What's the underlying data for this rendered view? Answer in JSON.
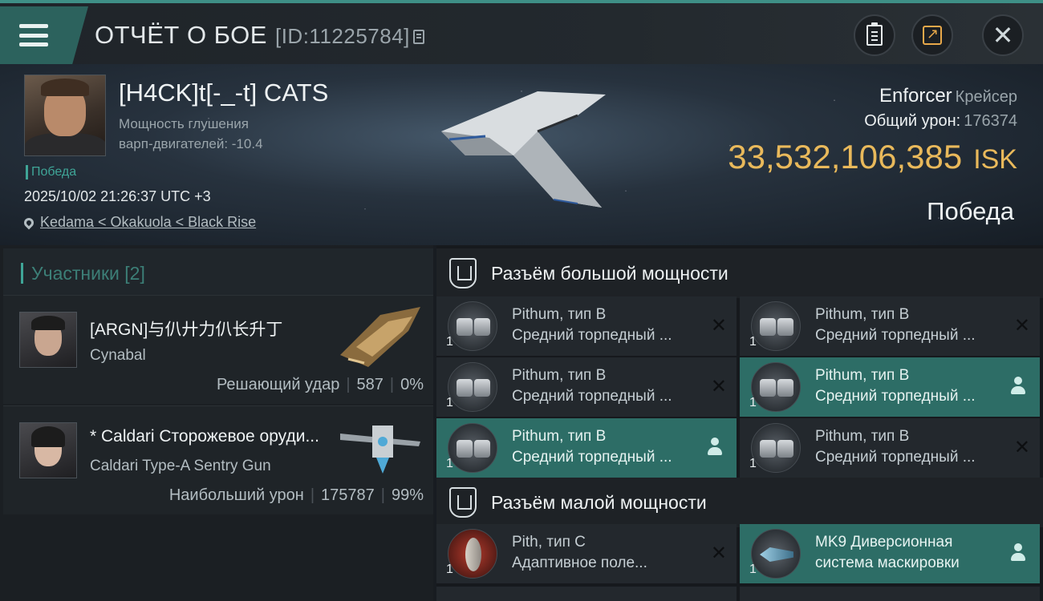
{
  "header": {
    "title": "ОТЧЁТ О БОЕ",
    "report_id": "[ID:11225784]",
    "icons": [
      "menu-icon",
      "copy-icon",
      "clipboard-icon",
      "share-icon",
      "close-icon"
    ]
  },
  "victim": {
    "pilot_name": "[H4CK]t[-_-t] CATS",
    "attribute_line1": "Мощность глушения",
    "attribute_line2": "варп-двигателей: -10.4",
    "tag": "Победа",
    "datetime": "2025/10/02 21:26:37 UTC +3",
    "location": "Kedama < Okakuola < Black Rise",
    "ship_name": "Enforcer",
    "ship_class": "Крейсер",
    "damage_label": "Общий урон:",
    "damage_value": "176374",
    "isk_value": "33,532,106,385",
    "isk_unit": "ISK",
    "result": "Победа"
  },
  "participants": {
    "header": "Участники [2]",
    "rows": [
      {
        "name": "[ARGN]与仈廾力仈长升丁",
        "ship": "Cynabal",
        "role": "Решающий удар",
        "damage": "587",
        "percent": "0%"
      },
      {
        "name": "* Caldari Сторожевое оруди...",
        "ship": "Caldari Type-A Sentry Gun",
        "role": "Наибольший урон",
        "damage": "175787",
        "percent": "99%"
      }
    ]
  },
  "modules": {
    "high_title": "Разъём большой мощности",
    "low_title": "Разъём малой мощности",
    "high": [
      {
        "name": "Pithum, тип B",
        "desc": "Средний торпедный ...",
        "qty": "1",
        "state": "destroyed"
      },
      {
        "name": "Pithum, тип B",
        "desc": "Средний торпедный ...",
        "qty": "1",
        "state": "destroyed"
      },
      {
        "name": "Pithum, тип B",
        "desc": "Средний торпедный ...",
        "qty": "1",
        "state": "destroyed"
      },
      {
        "name": "Pithum, тип B",
        "desc": "Средний торпедный ...",
        "qty": "1",
        "state": "dropped"
      },
      {
        "name": "Pithum, тип B",
        "desc": "Средний торпедный ...",
        "qty": "1",
        "state": "dropped"
      },
      {
        "name": "Pithum, тип B",
        "desc": "Средний торпедный ...",
        "qty": "1",
        "state": "destroyed"
      }
    ],
    "low": [
      {
        "name": "Pith, тип C",
        "desc": "Адаптивное поле...",
        "qty": "1",
        "state": "destroyed"
      },
      {
        "name": "MK9 Диверсионная",
        "desc": "система маскировки",
        "qty": "1",
        "state": "dropped"
      }
    ],
    "state_icons": {
      "destroyed": "close-icon",
      "dropped": "user-icon"
    }
  },
  "colors": {
    "accent": "#3fa597",
    "isk": "#e9b95b",
    "active_module": "#2d6d66"
  }
}
